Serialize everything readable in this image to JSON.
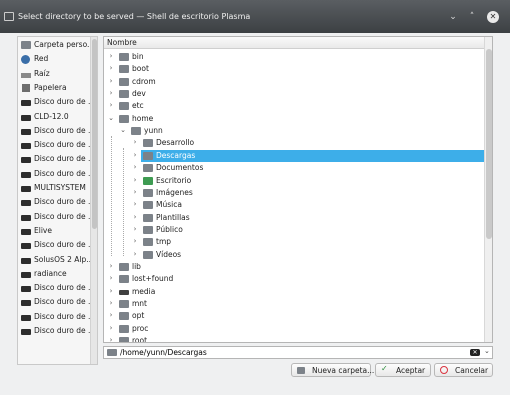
{
  "window": {
    "title": "Select directory to be served — Shell de escritorio Plasma",
    "minimize_glyph": "⌄",
    "maximize_glyph": "˄",
    "close_glyph": "✕"
  },
  "places": [
    {
      "label": "Carpeta perso...",
      "icon": "folder"
    },
    {
      "label": "Red",
      "icon": "net"
    },
    {
      "label": "Raíz",
      "icon": "root"
    },
    {
      "label": "Papelera",
      "icon": "trash"
    },
    {
      "label": "Disco duro de ...",
      "icon": "disk"
    },
    {
      "label": "CLD-12.0",
      "icon": "disk"
    },
    {
      "label": "Disco duro de ...",
      "icon": "disk"
    },
    {
      "label": "Disco duro de ...",
      "icon": "disk"
    },
    {
      "label": "Disco duro de ...",
      "icon": "disk"
    },
    {
      "label": "Disco duro de ...",
      "icon": "disk"
    },
    {
      "label": "MULTISYSTEM",
      "icon": "disk"
    },
    {
      "label": "Disco duro de ...",
      "icon": "disk"
    },
    {
      "label": "Disco duro de ...",
      "icon": "disk"
    },
    {
      "label": "Elive",
      "icon": "disk"
    },
    {
      "label": "Disco duro de ...",
      "icon": "disk"
    },
    {
      "label": "SolusOS 2 Alp...",
      "icon": "disk"
    },
    {
      "label": "radiance",
      "icon": "disk"
    },
    {
      "label": "Disco duro de ...",
      "icon": "disk"
    },
    {
      "label": "Disco duro de ...",
      "icon": "disk"
    },
    {
      "label": "Disco duro de ...",
      "icon": "disk"
    },
    {
      "label": "Disco duro de ...",
      "icon": "disk"
    }
  ],
  "tree": {
    "header": "Nombre",
    "rows": [
      {
        "label": "bin",
        "depth": 0,
        "arrow": "›",
        "icon": "folder"
      },
      {
        "label": "boot",
        "depth": 0,
        "arrow": "›",
        "icon": "folder"
      },
      {
        "label": "cdrom",
        "depth": 0,
        "arrow": "›",
        "icon": "folder"
      },
      {
        "label": "dev",
        "depth": 0,
        "arrow": "›",
        "icon": "folder"
      },
      {
        "label": "etc",
        "depth": 0,
        "arrow": "›",
        "icon": "folder"
      },
      {
        "label": "home",
        "depth": 0,
        "arrow": "⌄",
        "icon": "folder"
      },
      {
        "label": "yunn",
        "depth": 1,
        "arrow": "⌄",
        "icon": "folder"
      },
      {
        "label": "Desarrollo",
        "depth": 2,
        "arrow": "›",
        "icon": "folder"
      },
      {
        "label": "Descargas",
        "depth": 2,
        "arrow": "›",
        "icon": "folder",
        "selected": true
      },
      {
        "label": "Documentos",
        "depth": 2,
        "arrow": "›",
        "icon": "folder"
      },
      {
        "label": "Escritorio",
        "depth": 2,
        "arrow": "›",
        "icon": "green"
      },
      {
        "label": "Imágenes",
        "depth": 2,
        "arrow": "›",
        "icon": "folder"
      },
      {
        "label": "Música",
        "depth": 2,
        "arrow": "›",
        "icon": "folder"
      },
      {
        "label": "Plantillas",
        "depth": 2,
        "arrow": "›",
        "icon": "folder"
      },
      {
        "label": "Público",
        "depth": 2,
        "arrow": "›",
        "icon": "folder"
      },
      {
        "label": "tmp",
        "depth": 2,
        "arrow": "›",
        "icon": "folder"
      },
      {
        "label": "Vídeos",
        "depth": 2,
        "arrow": "›",
        "icon": "folder"
      },
      {
        "label": "lib",
        "depth": 0,
        "arrow": "›",
        "icon": "folder"
      },
      {
        "label": "lost+found",
        "depth": 0,
        "arrow": "›",
        "icon": "folder"
      },
      {
        "label": "media",
        "depth": 0,
        "arrow": "›",
        "icon": "dark"
      },
      {
        "label": "mnt",
        "depth": 0,
        "arrow": "›",
        "icon": "folder"
      },
      {
        "label": "opt",
        "depth": 0,
        "arrow": "›",
        "icon": "folder"
      },
      {
        "label": "proc",
        "depth": 0,
        "arrow": "›",
        "icon": "folder"
      },
      {
        "label": "root",
        "depth": 0,
        "arrow": "›",
        "icon": "folder"
      }
    ]
  },
  "path": {
    "value": "/home/yunn/Descargas",
    "clear_glyph": "✕",
    "dropdown_glyph": "⌄"
  },
  "buttons": {
    "new_folder": "Nueva carpeta...",
    "accept": "Aceptar",
    "accept_glyph": "✓",
    "cancel": "Cancelar"
  },
  "colors": {
    "selection": "#3daee9",
    "titlebar": "#3c4043"
  }
}
